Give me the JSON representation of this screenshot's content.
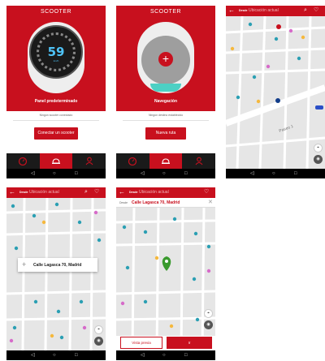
{
  "colors": {
    "brand_red": "#c8101e",
    "dark": "#1a1a1a",
    "teal": "#4dd0c4",
    "map_bg": "#e6e6e6"
  },
  "screen1": {
    "title": "SCOOTER",
    "speed": "59",
    "speed_unit": "km/h",
    "panel_label": "Panel predeterminado",
    "status": "Ningún scooter conectado",
    "connect_button": "Conectar un scooter"
  },
  "screen2": {
    "title": "SCOOTER",
    "panel_label": "Navegación",
    "status": "Ningún destino establecido",
    "new_route_button": "Nueva ruta"
  },
  "map_header": {
    "from_label": "Desde",
    "location_placeholder": "Ubicación actual"
  },
  "screen3": {
    "street_label": "Paseo 1"
  },
  "screen4": {
    "address": "Calle Lagasca 70, Madrid"
  },
  "screen5": {
    "from_label": "Desde",
    "address": "Calle Lagasca 70, Madrid",
    "preview_button": "Vista previa",
    "go_button": "Ir"
  },
  "tabs": [
    {
      "icon": "speedometer-icon"
    },
    {
      "icon": "scooter-icon"
    },
    {
      "icon": "profile-icon"
    }
  ],
  "android_nav": {
    "back": "◁",
    "home": "○",
    "recents": "□"
  }
}
